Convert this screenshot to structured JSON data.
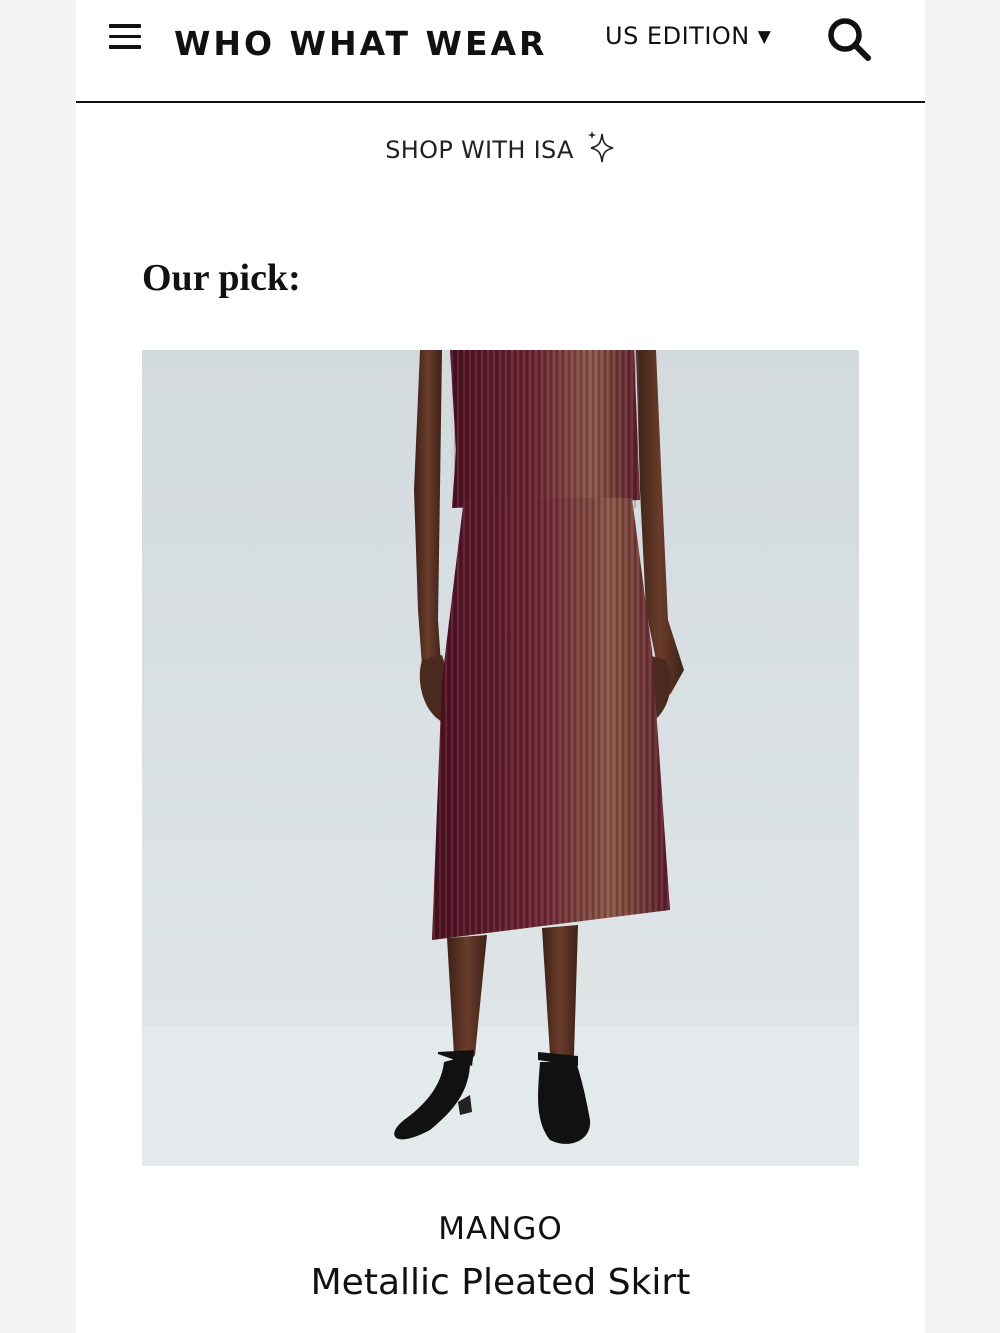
{
  "header": {
    "logo": "WHO WHAT WEAR",
    "edition_label": "US EDITION",
    "edition_caret": "▼",
    "icons": {
      "menu": "hamburger-menu-icon",
      "search": "search-icon"
    }
  },
  "shop_banner": {
    "label": "SHOP WITH ISA",
    "icon": "sparkle-icon"
  },
  "article": {
    "pick_heading": "Our pick:",
    "product": {
      "brand": "MANGO",
      "name": "Metallic Pleated Skirt"
    }
  },
  "colors": {
    "page_bg": "#ffffff",
    "outer_bg": "#f4f4f4",
    "text": "#111111",
    "skirt": "#5a1a2b",
    "backdrop": "#dde3e6"
  }
}
